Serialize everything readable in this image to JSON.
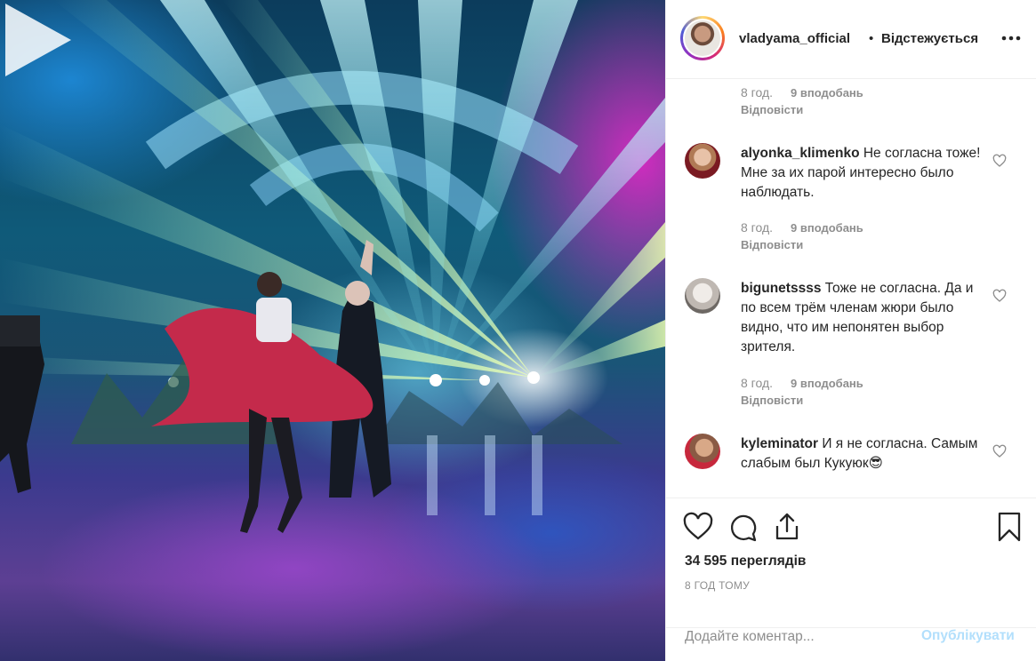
{
  "post": {
    "author": "vladyama_official",
    "dot": "•",
    "follow_status": "Відстежується"
  },
  "comments": [
    {
      "meta_time": "8 год.",
      "meta_likes": "9 вподобань",
      "reply_label": "Відповісти"
    },
    {
      "username": "alyonka_klimenko",
      "text": "Не согласна тоже! Мне за их парой интересно было наблюдать.",
      "meta_time": "8 год.",
      "meta_likes": "9 вподобань",
      "reply_label": "Відповісти"
    },
    {
      "username": "bigunetssss",
      "text": "Тоже не согласна.⁡ Да и по всем трём членам жюри было видно, что им непонятен выбор зрителя.",
      "meta_time": "8 год.",
      "meta_likes": "9 вподобань",
      "reply_label": "Відповісти"
    },
    {
      "username": "kyleminator",
      "text": "И я не согласна. Самым слабым был Кукуюк😎"
    }
  ],
  "stats": {
    "views": "34 595 переглядів",
    "posted": "8 ГОД ТОМУ"
  },
  "composer": {
    "placeholder": "Додайте коментар...",
    "publish_label": "Опублікувати"
  },
  "icons": {
    "play": "play-icon",
    "more": "more-icon",
    "like": "heart-icon",
    "comment": "comment-icon",
    "share": "share-icon",
    "save": "bookmark-icon"
  },
  "colors": {
    "text": "#262626",
    "muted": "#8e8e8e",
    "publish_disabled": "#b2dffc",
    "border": "#efefef"
  }
}
